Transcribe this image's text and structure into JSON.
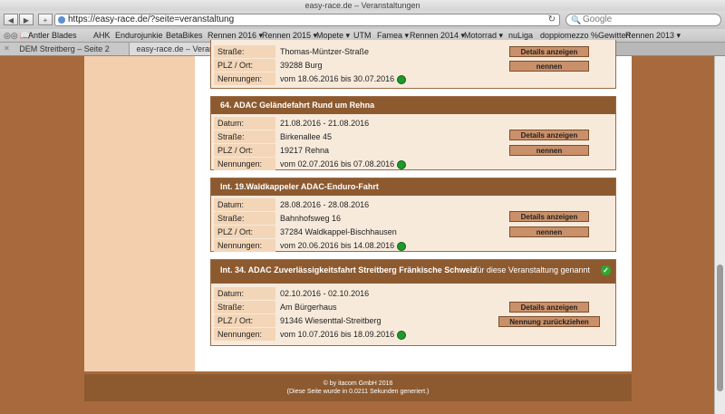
{
  "window": {
    "title": "easy-race.de – Veranstaltungen"
  },
  "toolbar": {
    "back": "◀",
    "forward": "▶",
    "add": "+",
    "url": "https://easy-race.de/?seite=veranstaltung",
    "reload": "↻",
    "search_placeholder": "Google"
  },
  "bookmarks": {
    "icons": "◎◎ 📖",
    "items": [
      "Antler Blades",
      "AHK",
      "Endurojunkie",
      "BetaBikes",
      "Rennen 2016 ▾",
      "Rennen 2015 ▾",
      "Mopete ▾",
      "UTM",
      "Famea ▾",
      "Rennen 2014 ▾",
      "Motorrad ▾",
      "nuLiga",
      "doppiomezzo %Gewitter!",
      "Rennen 2013 ▾"
    ]
  },
  "tabs": [
    {
      "label": "DEM Streitberg – Seite 2"
    },
    {
      "label": "easy-race.de – Veranstaltungen"
    }
  ],
  "labels": {
    "datum": "Datum:",
    "strasse": "Straße:",
    "plz": "PLZ / Ort:",
    "nennungen": "Nennungen:"
  },
  "buttons": {
    "details": "Details anzeigen",
    "nennen": "nennen",
    "zurueck": "Nennung zurückziehen"
  },
  "card0": {
    "strasse": "Thomas-Müntzer-Straße",
    "plz": "39288 Burg",
    "nennungen": "vom 18.06.2016 bis 30.07.2016"
  },
  "card1": {
    "title": "64. ADAC Geländefahrt Rund um Rehna",
    "datum": "21.08.2016 - 21.08.2016",
    "strasse": "Birkenallee 45",
    "plz": "19217 Rehna",
    "nennungen": "vom 02.07.2016 bis 07.08.2016"
  },
  "card2": {
    "title": "Int. 19.Waldkappeler ADAC-Enduro-Fahrt",
    "datum": "28.08.2016 - 28.08.2016",
    "strasse": "Bahnhofsweg 16",
    "plz": "37284 Waldkappel-Bischhausen",
    "nennungen": "vom 20.06.2016 bis 14.08.2016"
  },
  "card3": {
    "title": "Int. 34. ADAC Zuverlässigkeitsfahrt Streitberg Fränkische Schweiz",
    "status": "für diese Veranstaltung genannt",
    "datum": "02.10.2016 - 02.10.2016",
    "strasse": "Am Bürgerhaus",
    "plz": "91346 Wiesenttal-Streitberg",
    "nennungen": "vom 10.07.2016 bis 18.09.2016"
  },
  "footer": {
    "line1": "© by itacom GmbH 2016",
    "line2": "(Diese Seite wurde in 0.0211 Sekunden generiert.)"
  }
}
